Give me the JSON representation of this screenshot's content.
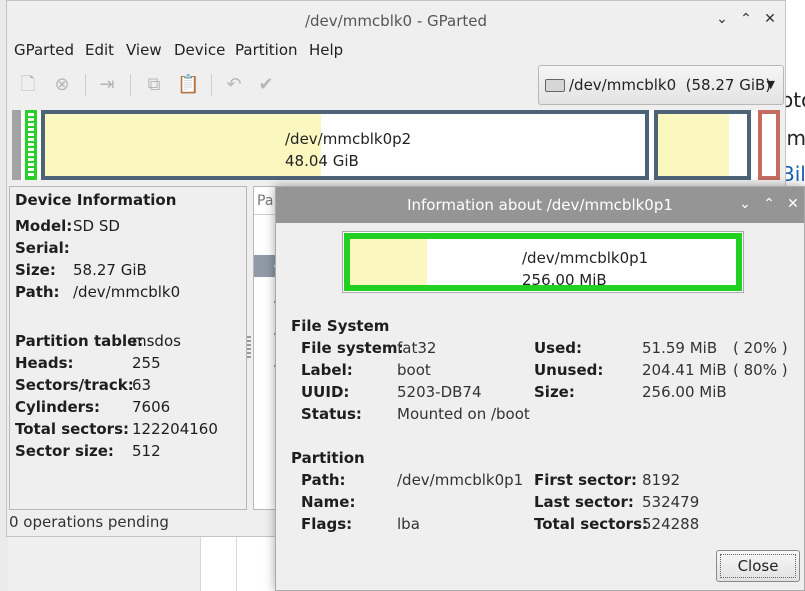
{
  "background": {
    "partial_texts": [
      "oto",
      "im",
      "Bild"
    ],
    "link_color": "#1a5fb4"
  },
  "main_window": {
    "title": "/dev/mmcblk0 - GParted",
    "controls": {
      "minimize": "⌄",
      "maximize": "⌃",
      "close": "✕"
    },
    "menu": [
      "GParted",
      "Edit",
      "View",
      "Device",
      "Partition",
      "Help"
    ],
    "toolbar_icons": [
      "new-icon",
      "delete-icon",
      "resize-move-icon",
      "copy-icon",
      "paste-icon",
      "undo-icon",
      "apply-icon"
    ],
    "device_selector": {
      "value": "/dev/mmcblk0  (58.27 GiB)"
    },
    "partition_graph": {
      "main": {
        "label": "/dev/mmcblk0p2",
        "size": "48.04 GiB",
        "used_fraction": 0.46
      },
      "extended_used_fraction": 0.8,
      "colors": {
        "fat32": "#2ad02a",
        "ext4": "#4d6478",
        "used": "#fbf8bf",
        "unallocated": "#a3a3a3",
        "other": "#c56b5f"
      }
    },
    "device_info": {
      "heading": "Device Information",
      "rows_a": [
        {
          "k": "Model:",
          "v": "SD SD"
        },
        {
          "k": "Serial:",
          "v": ""
        },
        {
          "k": "Size:",
          "v": "58.27 GiB"
        },
        {
          "k": "Path:",
          "v": "/dev/mmcblk0"
        }
      ],
      "rows_b": [
        {
          "k": "Partition table:",
          "v": "msdos"
        },
        {
          "k": "Heads:",
          "v": "255"
        },
        {
          "k": "Sectors/track:",
          "v": "63"
        },
        {
          "k": "Cylinders:",
          "v": "7606"
        },
        {
          "k": "Total sectors:",
          "v": "122204160"
        },
        {
          "k": "Sector size:",
          "v": "512"
        }
      ]
    },
    "partition_list": {
      "header": "Pa",
      "rows": [
        "u",
        "/",
        "/",
        "/",
        "/"
      ]
    },
    "status": "0 operations pending"
  },
  "dialog": {
    "title": "Information about /dev/mmcblk0p1",
    "controls": {
      "minimize": "⌄",
      "maximize": "⌃",
      "close": "✕"
    },
    "graph": {
      "label": "/dev/mmcblk0p1",
      "size": "256.00 MiB",
      "used_fraction": 0.2
    },
    "file_system": {
      "heading": "File System",
      "left": [
        {
          "k": "File system:",
          "v": "fat32"
        },
        {
          "k": "Label:",
          "v": "boot"
        },
        {
          "k": "UUID:",
          "v": "5203-DB74"
        },
        {
          "k": "Status:",
          "v": "Mounted on /boot"
        }
      ],
      "right": [
        {
          "k": "Used:",
          "v": "51.59 MiB",
          "pct": "( 20% )"
        },
        {
          "k": "Unused:",
          "v": "204.41 MiB",
          "pct": "( 80% )"
        },
        {
          "k": "Size:",
          "v": "256.00 MiB",
          "pct": ""
        }
      ]
    },
    "partition": {
      "heading": "Partition",
      "left": [
        {
          "k": "Path:",
          "v": "/dev/mmcblk0p1"
        },
        {
          "k": "Name:",
          "v": ""
        },
        {
          "k": "Flags:",
          "v": "lba"
        }
      ],
      "right": [
        {
          "k": "First sector:",
          "v": "8192"
        },
        {
          "k": "Last sector:",
          "v": "532479"
        },
        {
          "k": "Total sectors:",
          "v": "524288"
        }
      ]
    },
    "close_label": "Close"
  }
}
